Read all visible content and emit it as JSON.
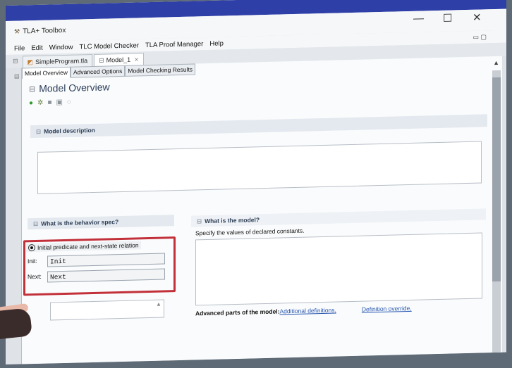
{
  "window": {
    "title": "TLA+ Toolbox",
    "controls": {
      "minimize": "—",
      "maximize": "☐",
      "close": "✕"
    }
  },
  "menu": {
    "items": [
      "File",
      "Edit",
      "Window",
      "TLC Model Checker",
      "TLA Proof Manager",
      "Help"
    ],
    "right_controls": "▭ ▢"
  },
  "editor_tabs": [
    {
      "label": "SimpleProgram.tla",
      "active": false
    },
    {
      "label": "Model_1",
      "active": true,
      "close": "✕"
    }
  ],
  "page_tabs": [
    "Model Overview",
    "Advanced Options",
    "Model Checking Results"
  ],
  "overview": {
    "title": "Model Overview",
    "toolbar_icons": [
      "run-icon",
      "tools-icon",
      "stop-icon",
      "lock-icon",
      "eye-icon"
    ]
  },
  "model_description": {
    "header": "Model description"
  },
  "behavior_spec": {
    "header": "What is the behavior spec?",
    "option_label": "Initial predicate and next-state relation",
    "init_label": "Init:",
    "init_value": "Init",
    "next_label": "Next:",
    "next_value": "Next"
  },
  "model": {
    "header": "What is the model?",
    "subtitle": "Specify the values of declared constants.",
    "advanced_label": "Advanced parts of the model:",
    "additional_link": "Additional definitions,",
    "override_link": "Definition override,"
  },
  "colors": {
    "accent": "#2f3fa8",
    "highlight_box": "#c2303a",
    "link": "#2556b0"
  }
}
